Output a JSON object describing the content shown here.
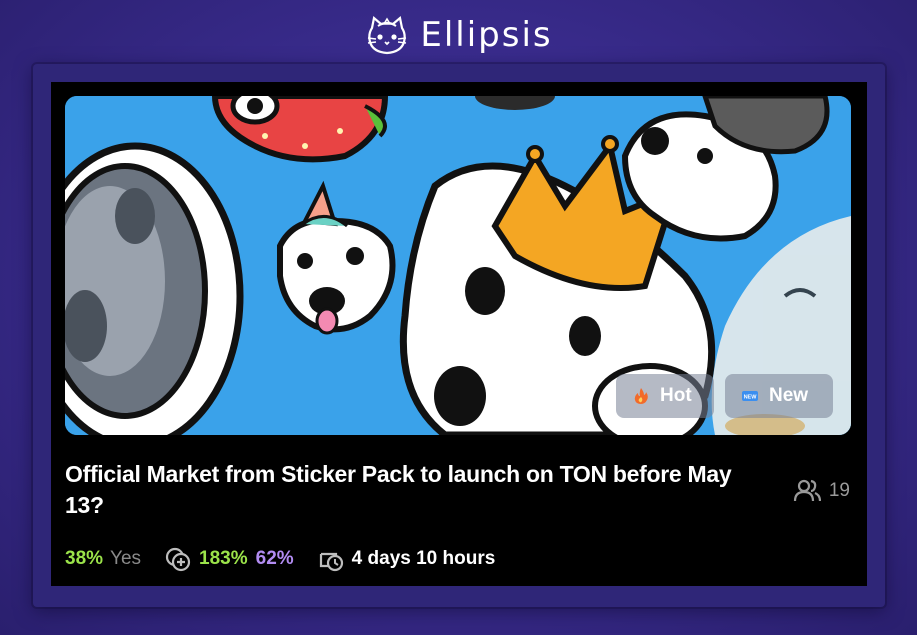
{
  "brand": {
    "name": "Ellipsis",
    "logo_icon": "cat-astronaut-logo"
  },
  "market": {
    "title": "Official Market from Sticker Pack to launch on TON before May 13?",
    "participants_count": "19",
    "tags": [
      {
        "label": "Hot",
        "icon": "fire-icon"
      },
      {
        "label": "New",
        "icon": "new-badge-icon"
      }
    ],
    "yes_percent": "38%",
    "yes_label": "Yes",
    "return_percent": "183%",
    "second_percent": "62%",
    "time_left": "4 days 10 hours"
  },
  "colors": {
    "background": "#3a2c8e",
    "card": "#000000",
    "green": "#9be34a",
    "purple": "#b28cf2",
    "muted": "#8a8a8a"
  }
}
